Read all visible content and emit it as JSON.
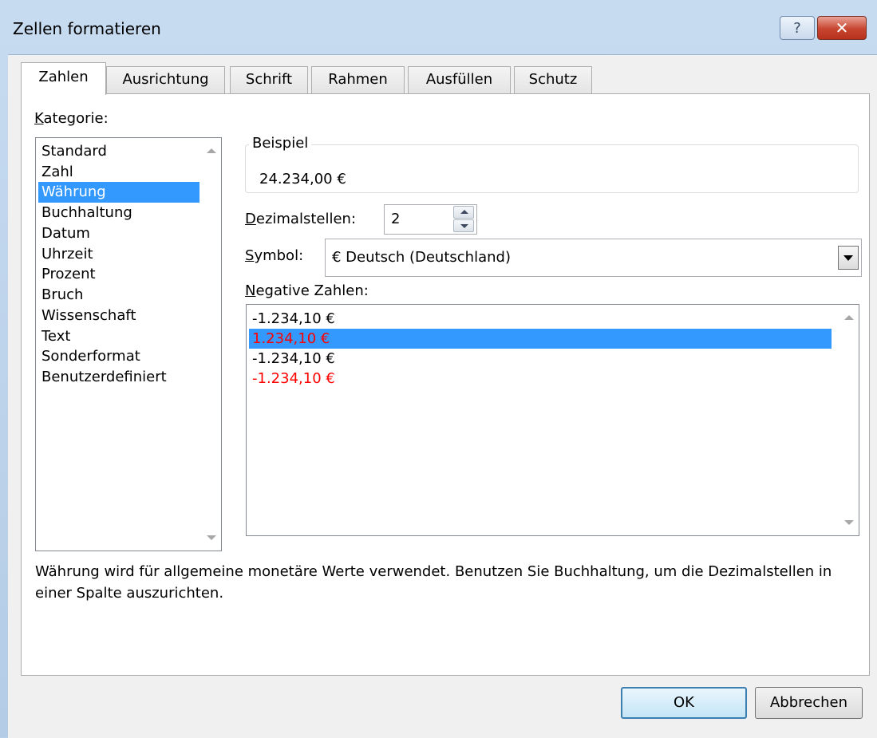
{
  "window": {
    "title": "Zellen formatieren",
    "help_glyph": "?",
    "close_glyph": "✕"
  },
  "tabs": [
    {
      "label": "Zahlen",
      "active": true
    },
    {
      "label": "Ausrichtung",
      "active": false
    },
    {
      "label": "Schrift",
      "active": false
    },
    {
      "label": "Rahmen",
      "active": false
    },
    {
      "label": "Ausfüllen",
      "active": false
    },
    {
      "label": "Schutz",
      "active": false
    }
  ],
  "category": {
    "label_hotkey": "K",
    "label_rest": "ategorie:",
    "items": [
      "Standard",
      "Zahl",
      "Währung",
      "Buchhaltung",
      "Datum",
      "Uhrzeit",
      "Prozent",
      "Bruch",
      "Wissenschaft",
      "Text",
      "Sonderformat",
      "Benutzerdefiniert"
    ],
    "selected": "Währung"
  },
  "sample": {
    "legend": "Beispiel",
    "value": "24.234,00 €"
  },
  "decimals": {
    "label_hotkey": "D",
    "label_rest": "ezimalstellen:",
    "value": "2"
  },
  "symbol": {
    "label_hotkey": "S",
    "label_rest": "ymbol:",
    "value": "€ Deutsch (Deutschland)"
  },
  "negative": {
    "label_hotkey": "N",
    "label_rest": "egative Zahlen:",
    "items": [
      {
        "text": "-1.234,10 €",
        "color": "#000000"
      },
      {
        "text": "1.234,10 €",
        "color": "#ff0000"
      },
      {
        "text": "-1.234,10 €",
        "color": "#000000"
      },
      {
        "text": "-1.234,10 €",
        "color": "#ff0000"
      }
    ],
    "selected_index": 1
  },
  "description": "Währung wird für allgemeine monetäre Werte verwendet. Benutzen Sie Buchhaltung, um die Dezimalstellen in einer Spalte auszurichten.",
  "buttons": {
    "ok": "OK",
    "cancel": "Abbrechen"
  },
  "colors": {
    "selection": "#3399ff",
    "negative_red": "#ff0000"
  }
}
